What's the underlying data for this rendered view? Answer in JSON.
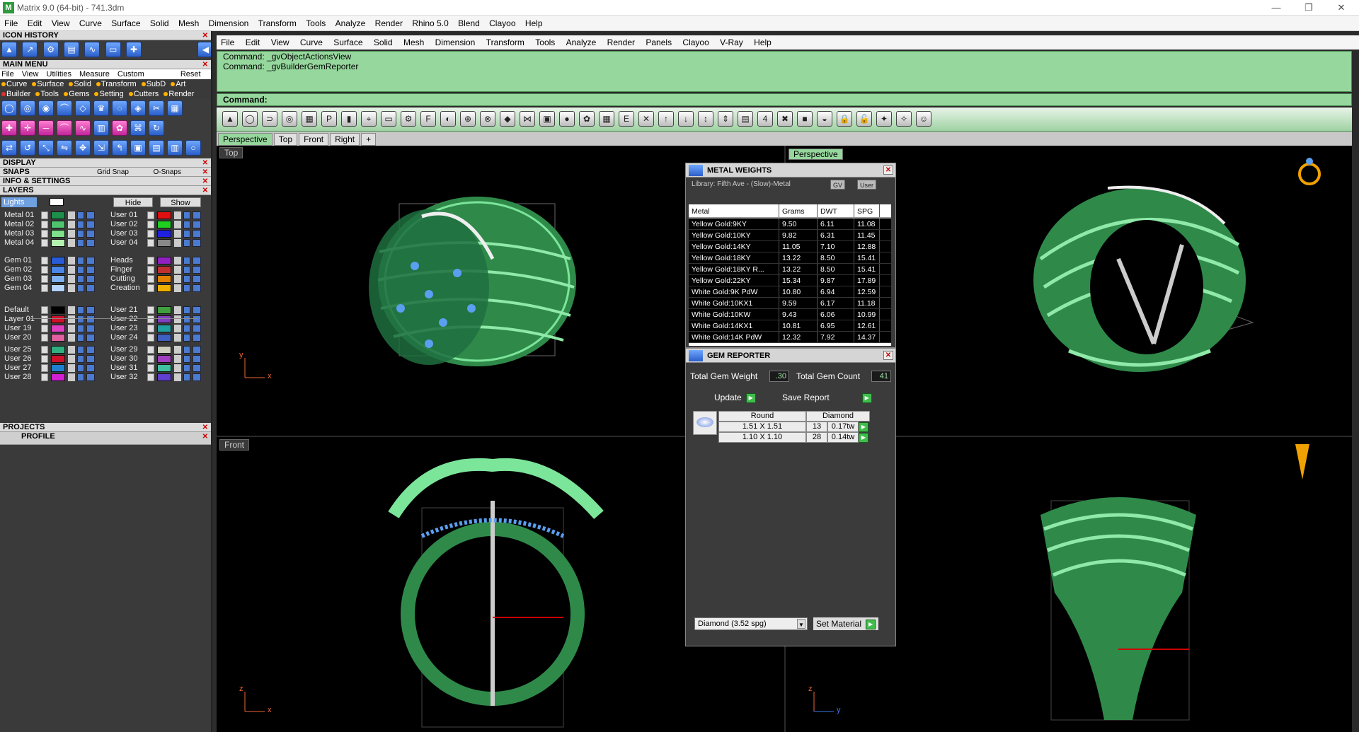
{
  "window": {
    "title": "Matrix 9.0 (64-bit) - 741.3dm",
    "controls": {
      "minimize": "—",
      "maximize": "❐",
      "close": "✕"
    }
  },
  "top_menu": [
    "File",
    "Edit",
    "View",
    "Curve",
    "Surface",
    "Solid",
    "Mesh",
    "Dimension",
    "Transform",
    "Tools",
    "Analyze",
    "Render",
    "Rhino 5.0",
    "Blend",
    "Clayoo",
    "Help"
  ],
  "left_panel": {
    "icon_history": "ICON HISTORY",
    "main_menu": "MAIN MENU",
    "main_menu_items": [
      "File",
      "View",
      "Utilities",
      "Measure",
      "Custom"
    ],
    "reset": "Reset",
    "categories_row1": [
      "Curve",
      "Surface",
      "Solid",
      "Transform",
      "SubD",
      "Art"
    ],
    "categories_row2": [
      "Builder",
      "Tools",
      "Gems",
      "Setting",
      "Cutters",
      "Render"
    ],
    "display": "DISPLAY",
    "snaps": "SNAPS",
    "grid_snap": "Grid Snap",
    "o_snaps": "O-Snaps",
    "info_settings": "INFO & SETTINGS",
    "layers": "LAYERS",
    "lights": "Lights",
    "hide": "Hide",
    "show": "Show",
    "layers_left": [
      {
        "name": "Metal 01",
        "color": "#1e8f4a"
      },
      {
        "name": "Metal 02",
        "color": "#4fc46f"
      },
      {
        "name": "Metal 03",
        "color": "#7ee08a"
      },
      {
        "name": "Metal 04",
        "color": "#b4f0b0"
      },
      {
        "name": "Gem 01",
        "color": "#2a5bd6"
      },
      {
        "name": "Gem 02",
        "color": "#4a86e8"
      },
      {
        "name": "Gem 03",
        "color": "#7fb0f0"
      },
      {
        "name": "Gem 04",
        "color": "#b5d4ff"
      },
      {
        "name": "Default",
        "color": "#000000"
      },
      {
        "name": "Layer 01",
        "color": "#d0102a"
      },
      {
        "name": "User 19",
        "color": "#e040c0"
      },
      {
        "name": "User 20",
        "color": "#e060a0"
      },
      {
        "name": "User 25",
        "color": "#30b080"
      },
      {
        "name": "User 26",
        "color": "#d0102a"
      },
      {
        "name": "User 27",
        "color": "#2080d0"
      },
      {
        "name": "User 28",
        "color": "#d020d0"
      }
    ],
    "layers_right": [
      {
        "name": "User 01",
        "color": "#e01010"
      },
      {
        "name": "User 02",
        "color": "#20d020"
      },
      {
        "name": "User 03",
        "color": "#2020e0"
      },
      {
        "name": "User 04",
        "color": "#888888"
      },
      {
        "name": "Heads",
        "color": "#9020c0"
      },
      {
        "name": "Finger",
        "color": "#c03030"
      },
      {
        "name": "Cutting",
        "color": "#e08000"
      },
      {
        "name": "Creation",
        "color": "#f0b000"
      },
      {
        "name": "User 21",
        "color": "#40a040"
      },
      {
        "name": "User 22",
        "color": "#8040c0"
      },
      {
        "name": "User 23",
        "color": "#20a0a0"
      },
      {
        "name": "User 24",
        "color": "#4060c0"
      },
      {
        "name": "User 29",
        "color": "#d0d0c0"
      },
      {
        "name": "User 30",
        "color": "#a040c0"
      },
      {
        "name": "User 31",
        "color": "#40c0a0"
      },
      {
        "name": "User 32",
        "color": "#6040d0"
      }
    ],
    "projects": "PROJECTS",
    "profile": "PROFILE"
  },
  "main_menu_bar": [
    "File",
    "Edit",
    "View",
    "Curve",
    "Surface",
    "Solid",
    "Mesh",
    "Dimension",
    "Transform",
    "Tools",
    "Analyze",
    "Render",
    "Panels",
    "Clayoo",
    "V-Ray",
    "Help"
  ],
  "command_history": [
    "Command: _gvObjectActionsView",
    "Command: _gvBuilderGemReporter"
  ],
  "command_prompt": "Command:",
  "viewport_tabs": [
    "Perspective",
    "Top",
    "Front",
    "Right"
  ],
  "viewports": {
    "top": "Top",
    "perspective": "Perspective",
    "front": "Front"
  },
  "metal_weights": {
    "title": "METAL WEIGHTS",
    "library": "Library: Fifth Ave - (Slow)-Metal",
    "gv": "GV",
    "user": "User",
    "headers": [
      "Metal",
      "Grams",
      "DWT",
      "SPG"
    ],
    "rows": [
      [
        "Yellow Gold:9KY",
        "9.50",
        "6.11",
        "11.08"
      ],
      [
        "Yellow Gold:10KY",
        "9.82",
        "6.31",
        "11.45"
      ],
      [
        "Yellow Gold:14KY",
        "11.05",
        "7.10",
        "12.88"
      ],
      [
        "Yellow Gold:18KY",
        "13.22",
        "8.50",
        "15.41"
      ],
      [
        "Yellow Gold:18KY R...",
        "13.22",
        "8.50",
        "15.41"
      ],
      [
        "Yellow Gold:22KY",
        "15.34",
        "9.87",
        "17.89"
      ],
      [
        "White Gold:9K PdW",
        "10.80",
        "6.94",
        "12.59"
      ],
      [
        "White Gold:10KX1",
        "9.59",
        "6.17",
        "11.18"
      ],
      [
        "White Gold:10KW",
        "9.43",
        "6.06",
        "10.99"
      ],
      [
        "White Gold:14KX1",
        "10.81",
        "6.95",
        "12.61"
      ],
      [
        "White Gold:14K PdW",
        "12.32",
        "7.92",
        "14.37"
      ]
    ]
  },
  "gem_reporter": {
    "title": "GEM REPORTER",
    "total_weight_label": "Total Gem Weight",
    "total_weight": ".30",
    "total_count_label": "Total Gem Count",
    "total_count": "41",
    "update": "Update",
    "save_report": "Save Report",
    "shape": "Round",
    "material": "Diamond",
    "rows": [
      [
        "1.51 X 1.51",
        "13",
        "0.17tw"
      ],
      [
        "1.10 X 1.10",
        "28",
        "0.14tw"
      ]
    ],
    "material_select": "Diamond     (3.52 spg)",
    "set_material": "Set Material"
  },
  "axis": {
    "x": "x",
    "y": "y",
    "z": "z"
  }
}
